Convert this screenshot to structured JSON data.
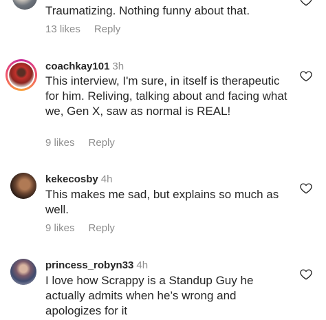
{
  "comments": [
    {
      "username": "",
      "time": "",
      "text": "Traumatizing. Nothing funny about that.",
      "likes": "13 likes",
      "reply": "Reply"
    },
    {
      "username": "coachkay101",
      "time": "3h",
      "text": "This interview, I'm sure, in itself is therapeutic for him. Reliving, talking about and facing what we, Gen X, saw as normal is REAL!",
      "likes": "9 likes",
      "reply": "Reply"
    },
    {
      "username": "kekecosby",
      "time": "4h",
      "text": "This makes me sad, but explains so much as well.",
      "likes": "9 likes",
      "reply": "Reply"
    },
    {
      "username": "princess_robyn33",
      "time": "4h",
      "text": "I love how Scrappy is a Standup Guy he actually admits when he’s wrong and apologizes for it",
      "likes": "",
      "reply": ""
    }
  ],
  "icons": {
    "like": "heart-outline-icon"
  },
  "colors": {
    "text": "#262626",
    "secondary": "#8e8e8e",
    "story_ring_start": "#f9a33a",
    "story_ring_end": "#c72b9a"
  }
}
